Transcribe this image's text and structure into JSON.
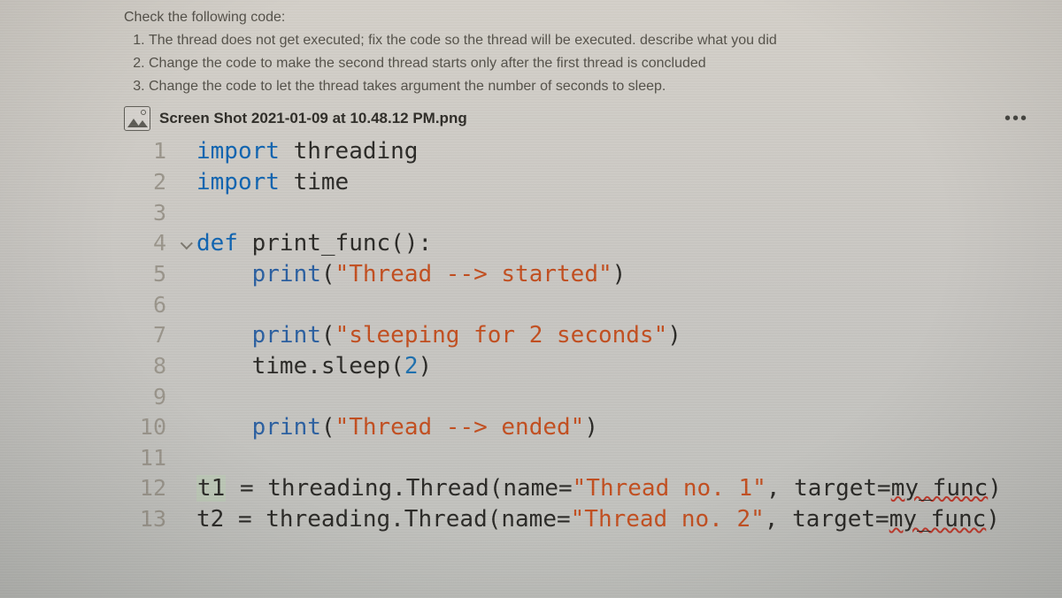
{
  "instructions": {
    "title": "Check the following code:",
    "items": [
      "The thread does not get executed; fix the code so the thread will be executed. describe what you did",
      "Change the code to make the second thread starts only after the first thread is concluded",
      "Change the code to let the thread takes argument the number of seconds to sleep."
    ]
  },
  "attachment": {
    "filename": "Screen Shot 2021-01-09 at 10.48.12 PM.png",
    "more_label": "•••"
  },
  "code": {
    "lines": [
      {
        "n": "1",
        "fold": "",
        "tokens": [
          {
            "t": "import ",
            "c": "kw-import"
          },
          {
            "t": "threading",
            "c": "kw-black"
          }
        ]
      },
      {
        "n": "2",
        "fold": "",
        "tokens": [
          {
            "t": "import ",
            "c": "kw-import"
          },
          {
            "t": "time",
            "c": "kw-black"
          }
        ]
      },
      {
        "n": "3",
        "fold": "",
        "tokens": []
      },
      {
        "n": "4",
        "fold": "v",
        "tokens": [
          {
            "t": "def ",
            "c": "kw-def"
          },
          {
            "t": "print_func",
            "c": "kw-black"
          },
          {
            "t": "():",
            "c": "kw-black"
          }
        ]
      },
      {
        "n": "5",
        "fold": "",
        "tokens": [
          {
            "t": "    ",
            "c": ""
          },
          {
            "t": "print",
            "c": "kw-func-call"
          },
          {
            "t": "(",
            "c": "kw-black"
          },
          {
            "t": "\"Thread --> started\"",
            "c": "kw-string"
          },
          {
            "t": ")",
            "c": "kw-black"
          }
        ]
      },
      {
        "n": "6",
        "fold": "",
        "tokens": []
      },
      {
        "n": "7",
        "fold": "",
        "tokens": [
          {
            "t": "    ",
            "c": ""
          },
          {
            "t": "print",
            "c": "kw-func-call"
          },
          {
            "t": "(",
            "c": "kw-black"
          },
          {
            "t": "\"sleeping for 2 seconds\"",
            "c": "kw-string"
          },
          {
            "t": ")",
            "c": "kw-black"
          }
        ]
      },
      {
        "n": "8",
        "fold": "",
        "tokens": [
          {
            "t": "    ",
            "c": ""
          },
          {
            "t": "time.sleep",
            "c": "kw-black"
          },
          {
            "t": "(",
            "c": "kw-black"
          },
          {
            "t": "2",
            "c": "kw-num"
          },
          {
            "t": ")",
            "c": "kw-black"
          }
        ]
      },
      {
        "n": "9",
        "fold": "",
        "tokens": []
      },
      {
        "n": "10",
        "fold": "",
        "tokens": [
          {
            "t": "    ",
            "c": ""
          },
          {
            "t": "print",
            "c": "kw-func-call"
          },
          {
            "t": "(",
            "c": "kw-black"
          },
          {
            "t": "\"Thread --> ended\"",
            "c": "kw-string"
          },
          {
            "t": ")",
            "c": "kw-black"
          }
        ]
      },
      {
        "n": "11",
        "fold": "",
        "tokens": []
      },
      {
        "n": "12",
        "fold": "",
        "tokens": [
          {
            "t": "t1",
            "c": "kw-black hl"
          },
          {
            "t": " = threading.Thread(name=",
            "c": "kw-black"
          },
          {
            "t": "\"Thread no. 1\"",
            "c": "kw-string"
          },
          {
            "t": ", target=",
            "c": "kw-black"
          },
          {
            "t": "my_func",
            "c": "kw-black errwave"
          },
          {
            "t": ")",
            "c": "kw-black"
          }
        ]
      },
      {
        "n": "13",
        "fold": "",
        "tokens": [
          {
            "t": "t2 = threading.Thread(name=",
            "c": "kw-black"
          },
          {
            "t": "\"Thread no. 2\"",
            "c": "kw-string"
          },
          {
            "t": ", target=",
            "c": "kw-black"
          },
          {
            "t": "my_func",
            "c": "kw-black errwave"
          },
          {
            "t": ")",
            "c": "kw-black"
          }
        ]
      }
    ]
  }
}
